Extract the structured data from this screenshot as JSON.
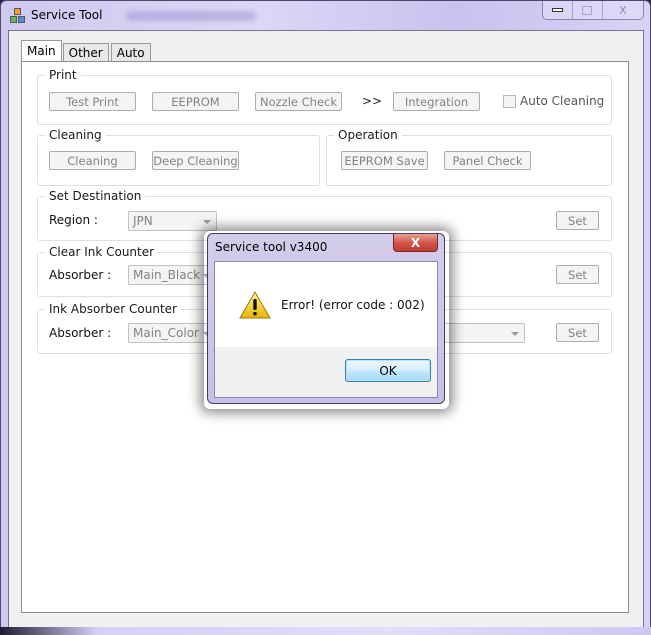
{
  "window": {
    "title": "Service Tool",
    "caption_buttons": {
      "minimize": "minimize",
      "maximize": "maximize",
      "close": "X"
    }
  },
  "tabs": [
    {
      "label": "Main",
      "active": true
    },
    {
      "label": "Other",
      "active": false
    },
    {
      "label": "Auto",
      "active": false
    }
  ],
  "print_group": {
    "label": "Print",
    "buttons": {
      "test_print": "Test Print",
      "eeprom": "EEPROM",
      "nozzle_check": "Nozzle Check",
      "separator": ">>",
      "integration": "Integration"
    },
    "auto_cleaning": {
      "label": "Auto Cleaning",
      "checked": false
    }
  },
  "cleaning_group": {
    "label": "Cleaning",
    "buttons": {
      "cleaning": "Cleaning",
      "deep_cleaning": "Deep Cleaning"
    }
  },
  "operation_group": {
    "label": "Operation",
    "buttons": {
      "eeprom_save": "EEPROM Save",
      "panel_check": "Panel Check"
    }
  },
  "set_destination": {
    "label": "Set Destination",
    "field_label": "Region :",
    "value": "JPN",
    "set_button": "Set"
  },
  "clear_ink_counter": {
    "label": "Clear Ink Counter",
    "field_label": "Absorber :",
    "value": "Main_Black",
    "set_button": "Set"
  },
  "ink_absorber_counter": {
    "label": "Ink Absorber Counter",
    "field_label": "Absorber :",
    "value": "Main_Color",
    "value2": "",
    "set_button": "Set"
  },
  "dialog": {
    "title": "Service tool v3400",
    "close": "X",
    "icon": "warning-icon",
    "message": "Error! (error code : 002)",
    "ok_button": "OK"
  }
}
